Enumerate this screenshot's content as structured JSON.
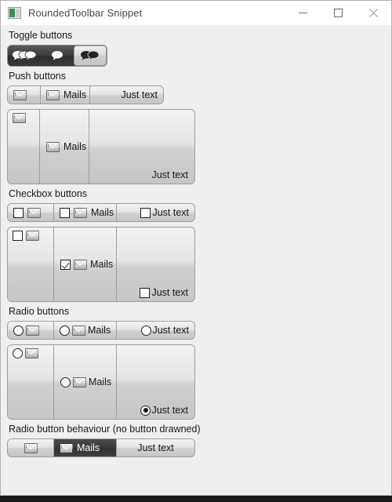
{
  "window": {
    "title": "RoundedToolbar Snippet",
    "icon": "app-window-icon",
    "caption": {
      "minimize": "minimize-icon",
      "maximize": "maximize-icon",
      "close": "close-icon"
    }
  },
  "sections": [
    {
      "id": "toggle",
      "label": "Toggle buttons",
      "toggles": [
        {
          "icon": "three-speech-bubbles-icon",
          "checked": false
        },
        {
          "icon": "one-speech-bubble-icon",
          "checked": false
        },
        {
          "icon": "two-speech-bubbles-icon",
          "checked": true
        }
      ]
    },
    {
      "id": "push",
      "label": "Push buttons",
      "row": [
        {
          "icon": "envelope-icon",
          "text": ""
        },
        {
          "icon": "envelope-icon",
          "text": "Mails"
        },
        {
          "icon": "",
          "text": "Just text"
        }
      ],
      "big": [
        {
          "icon": "envelope-icon",
          "text": "",
          "align": "top-left"
        },
        {
          "icon": "envelope-icon",
          "text": "Mails",
          "align": "middle-left"
        },
        {
          "icon": "",
          "text": "Just text",
          "align": "bottom-right"
        }
      ]
    },
    {
      "id": "checkbox",
      "label": "Checkbox buttons",
      "row": [
        {
          "checked": false,
          "icon": "envelope-icon",
          "text": ""
        },
        {
          "checked": false,
          "icon": "envelope-icon",
          "text": "Mails"
        },
        {
          "checked": false,
          "icon": "",
          "text": "Just text"
        }
      ],
      "big": [
        {
          "checked": false,
          "icon": "envelope-icon",
          "text": "",
          "align": "top-left"
        },
        {
          "checked": true,
          "icon": "envelope-icon",
          "text": "Mails",
          "align": "middle-left"
        },
        {
          "checked": false,
          "icon": "",
          "text": "Just text",
          "align": "bottom-right"
        }
      ]
    },
    {
      "id": "radio",
      "label": "Radio buttons",
      "row": [
        {
          "selected": false,
          "icon": "envelope-icon",
          "text": ""
        },
        {
          "selected": false,
          "icon": "envelope-icon",
          "text": "Mails"
        },
        {
          "selected": false,
          "icon": "",
          "text": "Just text"
        }
      ],
      "big": [
        {
          "selected": false,
          "icon": "envelope-icon",
          "text": "",
          "align": "top-left"
        },
        {
          "selected": false,
          "icon": "envelope-icon",
          "text": "Mails",
          "align": "middle-left"
        },
        {
          "selected": true,
          "icon": "",
          "text": "Just text",
          "align": "bottom-right"
        }
      ]
    },
    {
      "id": "radio-behaviour",
      "label": "Radio button behaviour (no button drawned)",
      "row": [
        {
          "icon": "envelope-icon",
          "text": "",
          "selected": false
        },
        {
          "icon": "envelope-icon",
          "text": "Mails",
          "selected": true
        },
        {
          "icon": "",
          "text": "Just text",
          "selected": false
        }
      ]
    }
  ],
  "colors": {
    "window_bg": "#efefef",
    "titlebar_bg": "#ffffff",
    "toolbar_border": "#9e9e9e",
    "dark_toolbar": "#3c3c3c",
    "pressed_bg": "#3a3a3a",
    "text": "#1a1a1a"
  }
}
